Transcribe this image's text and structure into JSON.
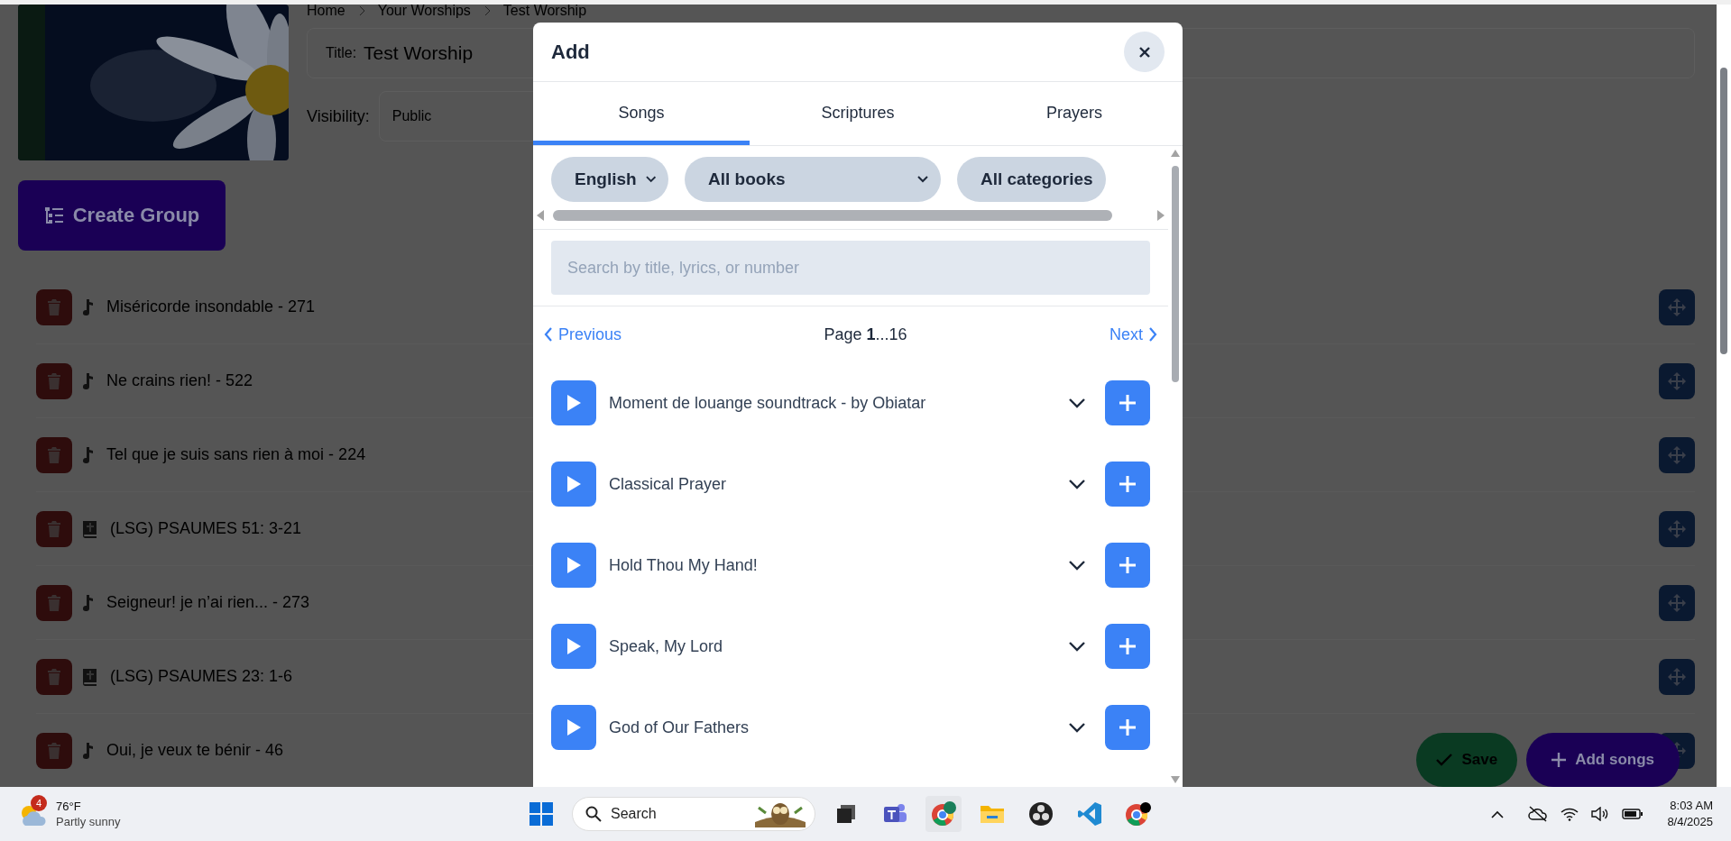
{
  "breadcrumb": [
    {
      "label": "Home"
    },
    {
      "label": "Your Worships"
    },
    {
      "label": "Test Worship"
    }
  ],
  "title_field": {
    "label": "Title:",
    "value": "Test Worship"
  },
  "visibility": {
    "label": "Visibility:",
    "value": "Public"
  },
  "create_group": "Create Group",
  "items": [
    {
      "kind": "song",
      "title": "Miséricorde insondable - 271"
    },
    {
      "kind": "song",
      "title": "Ne crains rien! - 522"
    },
    {
      "kind": "song",
      "title": "Tel que je suis sans rien à moi - 224"
    },
    {
      "kind": "scripture",
      "title": "(LSG) PSAUMES 51: 3-21"
    },
    {
      "kind": "song",
      "title": "Seigneur! je n’ai rien... - 273"
    },
    {
      "kind": "scripture",
      "title": "(LSG) PSAUMES 23: 1-6"
    },
    {
      "kind": "song",
      "title": "Oui, je veux te bénir - 46"
    }
  ],
  "actions": {
    "save": "Save",
    "add": "Add songs"
  },
  "modal": {
    "title": "Add",
    "tabs": [
      {
        "label": "Songs",
        "selected": true
      },
      {
        "label": "Scriptures",
        "selected": false
      },
      {
        "label": "Prayers",
        "selected": false
      }
    ],
    "filters": [
      {
        "value": "English"
      },
      {
        "value": "All books"
      },
      {
        "value": "All categories"
      }
    ],
    "search": {
      "placeholder": "Search by title, lyrics, or number"
    },
    "pagination": {
      "previous": "Previous",
      "page": "Page **1**...16",
      "next": "Next"
    },
    "results": [
      {
        "title": "Moment de louange soundtrack - by Obiatar"
      },
      {
        "title": "Classical Prayer"
      },
      {
        "title": "Hold Thou My Hand!"
      },
      {
        "title": "Speak, My Lord"
      },
      {
        "title": "God of Our Fathers"
      }
    ]
  },
  "taskbar": {
    "weather": {
      "badge": "4",
      "temp": "76°F",
      "desc": "Partly sunny"
    },
    "search": "Search",
    "time": "8:03 AM",
    "date": "8/4/2025"
  }
}
